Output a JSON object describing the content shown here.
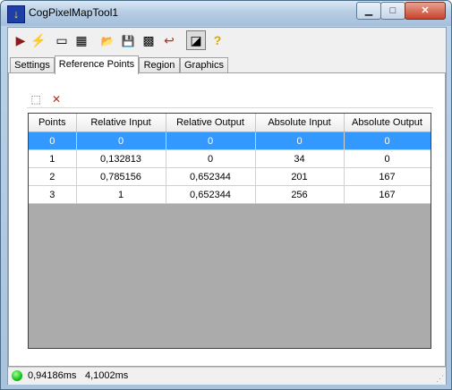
{
  "window": {
    "title": "CogPixelMapTool1",
    "minimize_label": "▁",
    "maximize_label": "□",
    "close_label": "✕"
  },
  "toolbar": {
    "buttons": [
      {
        "name": "run-icon",
        "glyph": "▶",
        "color": "#8b1a1a"
      },
      {
        "name": "lightning-icon",
        "glyph": "⚡",
        "color": "#e0b000"
      },
      {
        "name": "image-source-icon",
        "glyph": "▭",
        "color": "#333333"
      },
      {
        "name": "settings-icon",
        "glyph": "▦",
        "color": "#333333"
      },
      {
        "name": "open-folder-icon",
        "glyph": "📂",
        "color": "#c89a1a"
      },
      {
        "name": "save-icon",
        "glyph": "💾",
        "color": "#333333"
      },
      {
        "name": "grid-icon",
        "glyph": "▩",
        "color": "#333333"
      },
      {
        "name": "reset-icon",
        "glyph": "↩",
        "color": "#c0281c"
      },
      {
        "name": "graphics-icon",
        "glyph": "◪",
        "color": "#333333"
      },
      {
        "name": "help-icon",
        "glyph": "?",
        "color": "#d4a800"
      }
    ]
  },
  "tabs": [
    {
      "label": "Settings"
    },
    {
      "label": "Reference Points"
    },
    {
      "label": "Region"
    },
    {
      "label": "Graphics"
    }
  ],
  "selected_tab": "Reference Points",
  "grid_toolbar": {
    "add_glyph": "⬚",
    "delete_glyph": "✕"
  },
  "table": {
    "columns": [
      "Points",
      "Relative Input",
      "Relative Output",
      "Absolute Input",
      "Absolute Output"
    ],
    "rows": [
      [
        "0",
        "0",
        "0",
        "0",
        "0"
      ],
      [
        "1",
        "0,132813",
        "0",
        "34",
        "0"
      ],
      [
        "2",
        "0,785156",
        "0,652344",
        "201",
        "167"
      ],
      [
        "3",
        "1",
        "0,652344",
        "256",
        "167"
      ]
    ],
    "selected_row": 0
  },
  "status": {
    "indicator_color": "#14c414",
    "time1": "0,94186ms",
    "time2": "4,1002ms"
  }
}
